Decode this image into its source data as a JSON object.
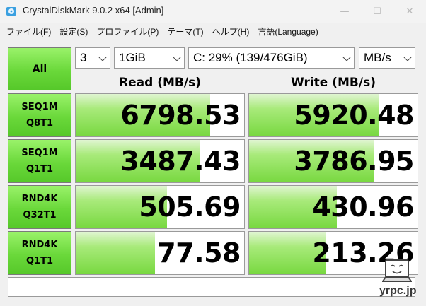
{
  "window": {
    "title": "CrystalDiskMark 9.0.2 x64 [Admin]",
    "minimize_glyph": "—",
    "maximize_glyph": "☐",
    "close_glyph": "✕"
  },
  "menu": [
    "ファイル(F)",
    "設定(S)",
    "プロファイル(P)",
    "テーマ(T)",
    "ヘルプ(H)",
    "言語(Language)"
  ],
  "controls": {
    "all_label": "All",
    "count": "3",
    "size": "1GiB",
    "drive": "C: 29% (139/476GiB)",
    "unit": "MB/s"
  },
  "headers": {
    "read": "Read (MB/s)",
    "write": "Write (MB/s)"
  },
  "tests": [
    {
      "line1": "SEQ1M",
      "line2": "Q8T1",
      "read": "6798.53",
      "write": "5920.48",
      "read_fill": 0.8,
      "write_fill": 0.77
    },
    {
      "line1": "SEQ1M",
      "line2": "Q1T1",
      "read": "3487.43",
      "write": "3786.95",
      "read_fill": 0.74,
      "write_fill": 0.74
    },
    {
      "line1": "RND4K",
      "line2": "Q32T1",
      "read": "505.69",
      "write": "430.96",
      "read_fill": 0.54,
      "write_fill": 0.52
    },
    {
      "line1": "RND4K",
      "line2": "Q1T1",
      "read": "77.58",
      "write": "213.26",
      "read_fill": 0.47,
      "write_fill": 0.46
    }
  ],
  "comment": "",
  "watermark": "yrpc.jp",
  "colors": {
    "accent_green": "#6ad83a",
    "bar_green": "#78d840"
  },
  "icons": {
    "app": "disk-icon",
    "mascot": "laptop-face-icon"
  }
}
